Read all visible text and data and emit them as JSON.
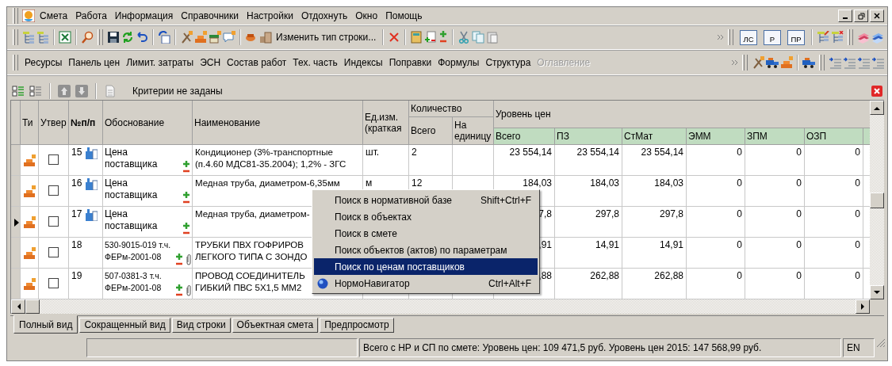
{
  "menu": [
    {
      "label": "Смета"
    },
    {
      "label": "Работа"
    },
    {
      "label": "Информация"
    },
    {
      "label": "Справочники"
    },
    {
      "label": "Настройки"
    },
    {
      "label": "Отдохнуть"
    },
    {
      "label": "Окно"
    },
    {
      "label": "Помощь"
    }
  ],
  "toolbar": {
    "change_row_type": "Изменить тип строки...",
    "estimate_buttons": [
      "ЛС",
      "Р",
      "ПР"
    ]
  },
  "panels": [
    {
      "label": "Ресурсы",
      "disabled": false
    },
    {
      "label": "Панель цен",
      "disabled": false
    },
    {
      "label": "Лимит. затраты",
      "disabled": false
    },
    {
      "label": "ЭСН",
      "disabled": false
    },
    {
      "label": "Состав работ",
      "disabled": false
    },
    {
      "label": "Тех. часть",
      "disabled": false
    },
    {
      "label": "Индексы",
      "disabled": false
    },
    {
      "label": "Поправки",
      "disabled": false
    },
    {
      "label": "Формулы",
      "disabled": false
    },
    {
      "label": "Структура",
      "disabled": false
    },
    {
      "label": "Оглавление",
      "disabled": true
    }
  ],
  "grid": {
    "filter_text": "Критерии не заданы",
    "columns": {
      "type": "Ти",
      "approved": "Утвер",
      "num": "№п/п",
      "basis": "Обоснование",
      "name": "Наименование",
      "unit": "Ед.изм.\n(краткая",
      "quantity": {
        "title": "Количество",
        "total": "Всего",
        "per_unit": "На\nединицу"
      },
      "price_level": {
        "title": "Уровень цен",
        "columns": [
          "Всего",
          "ПЗ",
          "СтМат",
          "ЭММ",
          "ЗПМ",
          "ОЗП"
        ]
      }
    },
    "rows": [
      {
        "num": "15",
        "kind": "supplier",
        "current": false,
        "approved": false,
        "basis": "Цена поставщика",
        "name": "Кондиционер (3%-транспортные\n(п.4.60 МДС81-35.2004); 1,2% - ЗГС",
        "unit": "шт.",
        "qty_total": "2",
        "prices": [
          "23 554,14",
          "23 554,14",
          "23 554,14",
          "0",
          "0",
          "0"
        ]
      },
      {
        "num": "16",
        "kind": "supplier",
        "current": false,
        "approved": false,
        "basis": "Цена поставщика",
        "name": "Медная труба, диаметром-6,35мм",
        "unit": "м",
        "qty_total": "12",
        "prices": [
          "184,03",
          "184,03",
          "184,03",
          "0",
          "0",
          "0"
        ]
      },
      {
        "num": "17",
        "kind": "supplier",
        "current": true,
        "approved": false,
        "basis": "Цена поставщика",
        "name": "Медная труба, диаметром-",
        "prices": [
          "7,8",
          "297,8",
          "297,8",
          "0",
          "0",
          "0"
        ]
      },
      {
        "num": "18",
        "kind": "norm",
        "current": false,
        "approved": false,
        "basis": "530-9015-019 т.ч.\nФЕРм-2001-08",
        "name": "ТРУБКИ ПВХ ГОФРИРОВ\nЛЕГКОГО ТИПА С ЗОНДО",
        "prices": [
          ",91",
          "14,91",
          "14,91",
          "0",
          "0",
          "0"
        ]
      },
      {
        "num": "19",
        "kind": "norm",
        "current": false,
        "approved": false,
        "basis": "507-0381-3 т.ч.\nФЕРм-2001-08",
        "name": "ПРОВОД СОЕДИНИТЕЛЬ\nГИБКИЙ ПВС 5Х1,5 ММ2",
        "prices": [
          ",88",
          "262,88",
          "262,88",
          "0",
          "0",
          "0"
        ]
      }
    ]
  },
  "context_menu": [
    {
      "label": "Поиск в нормативной базе",
      "shortcut": "Shift+Ctrl+F",
      "kind": "plain",
      "selected": false
    },
    {
      "label": "Поиск в объектах",
      "kind": "plain",
      "selected": false
    },
    {
      "label": "Поиск в смете",
      "kind": "plain",
      "selected": false
    },
    {
      "label": "Поиск объектов (актов) по параметрам",
      "kind": "plain",
      "selected": false
    },
    {
      "label": "Поиск по ценам поставщиков",
      "kind": "plain",
      "selected": true
    },
    {
      "label": "НормоНавигатор",
      "shortcut": "Ctrl+Alt+F",
      "kind": "navigator",
      "selected": false
    }
  ],
  "tabs": [
    {
      "label": "Полный вид",
      "selected": true
    },
    {
      "label": "Сокращенный вид",
      "selected": false
    },
    {
      "label": "Вид строки",
      "selected": false
    },
    {
      "label": "Объектная смета",
      "selected": false
    },
    {
      "label": "Предпросмотр",
      "selected": false
    }
  ],
  "status_bar": {
    "total": "Всего с НР и СП по смете: Уровень цен: 109 471,5 руб. Уровень цен 2015: 147 568,99 руб.",
    "language": "EN"
  }
}
